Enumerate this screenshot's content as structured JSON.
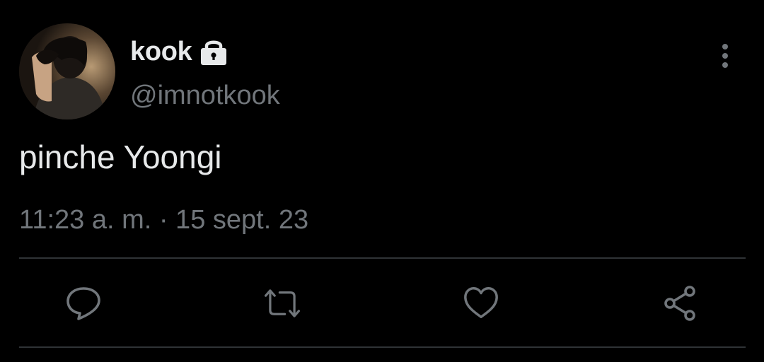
{
  "tweet": {
    "display_name": "kook",
    "handle": "@imnotkook",
    "text": "pinche Yoongi",
    "timestamp": "11:23 a. m. · 15 sept. 23",
    "protected": true
  },
  "icons": {
    "lock": "lock-icon",
    "more": "more-vertical-icon",
    "reply": "reply-icon",
    "retweet": "retweet-icon",
    "like": "heart-icon",
    "share": "share-icon"
  },
  "colors": {
    "background": "#000000",
    "primary_text": "#e7e9ea",
    "secondary_text": "#71767b",
    "divider": "#2f3336"
  }
}
